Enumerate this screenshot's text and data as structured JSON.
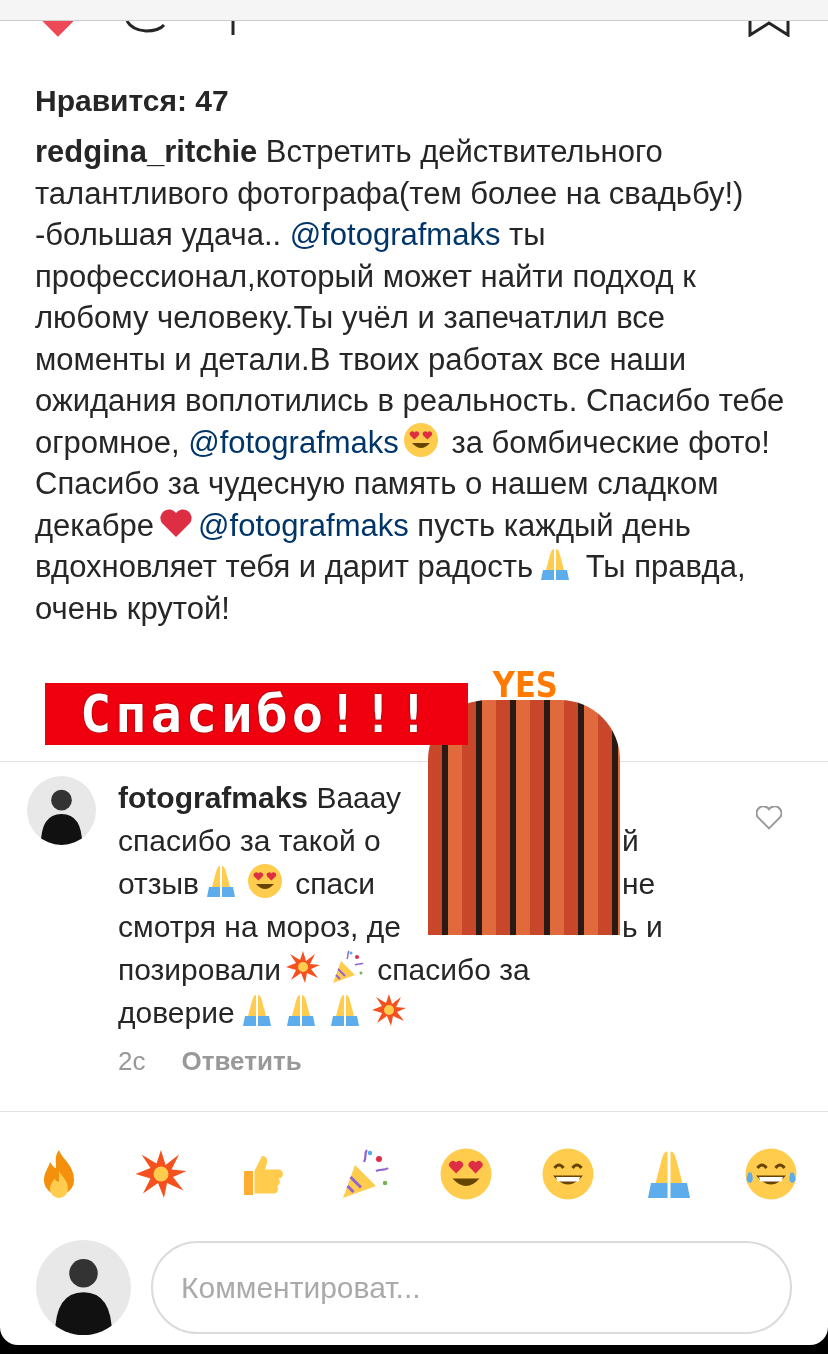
{
  "post_actions": {
    "liked": true
  },
  "likes": "Нравится: 47",
  "caption": [
    {
      "kind": "author",
      "text": "redgina_ritchie"
    },
    {
      "kind": "text",
      "text": " Встретить действительного талантливого фотографа(тем более на свадьбу!) -большая удача.. "
    },
    {
      "kind": "mention",
      "text": "@fotografmaks"
    },
    {
      "kind": "text",
      "text": " ты профессионал,который может найти подход к любому человеку.Ты учёл и запечатлил все моменты и детали.В твоих работах все наши ожидания воплотились в реальность. Спасибо тебе огромное, "
    },
    {
      "kind": "mention",
      "text": "@fotografmaks"
    },
    {
      "kind": "hearteyes"
    },
    {
      "kind": "text",
      "text": " за бомбические фото!Спасибо за чудесную память о нашем сладком декабре"
    },
    {
      "kind": "heart"
    },
    {
      "kind": "mention",
      "text": "@fotografmaks"
    },
    {
      "kind": "text",
      "text": " пусть каждый день вдохновляет тебя и дарит радость"
    },
    {
      "kind": "pray"
    },
    {
      "kind": "text",
      "text": " Ты правда, очень крутой!"
    }
  ],
  "stickers": {
    "banner": "Спасибо!!!",
    "yes": "YES"
  },
  "comment": {
    "author": "fotografmaks",
    "liked": false,
    "lines": [
      {
        "left": [
          {
            "kind": "text",
            "text": " Вааау"
          }
        ]
      },
      {
        "left": [
          {
            "kind": "text",
            "text": "спасибо за такой о"
          }
        ],
        "right": "й"
      },
      {
        "left": [
          {
            "kind": "text",
            "text": "отзыв"
          },
          {
            "kind": "pray"
          },
          {
            "kind": "hearteyes"
          },
          {
            "kind": "text",
            "text": " спаси"
          }
        ],
        "right": "не"
      },
      {
        "left": [
          {
            "kind": "text",
            "text": "смотря на мороз, де"
          }
        ],
        "right": "ь и"
      },
      {
        "left": [
          {
            "kind": "text",
            "text": "позировали"
          },
          {
            "kind": "boom"
          },
          {
            "kind": "party"
          },
          {
            "kind": "text",
            "text": " спасибо за"
          }
        ]
      },
      {
        "left": [
          {
            "kind": "text",
            "text": "доверие"
          },
          {
            "kind": "pray"
          },
          {
            "kind": "pray"
          },
          {
            "kind": "pray"
          },
          {
            "kind": "boom"
          }
        ]
      }
    ],
    "time": "2с",
    "reply": "Ответить"
  },
  "emoji_bar": [
    {
      "kind": "fire"
    },
    {
      "kind": "boom"
    },
    {
      "kind": "thumbsup"
    },
    {
      "kind": "party"
    },
    {
      "kind": "hearteyes"
    },
    {
      "kind": "grin"
    },
    {
      "kind": "pray"
    },
    {
      "kind": "joy"
    }
  ],
  "composer": {
    "placeholder": "Комментироват..."
  }
}
